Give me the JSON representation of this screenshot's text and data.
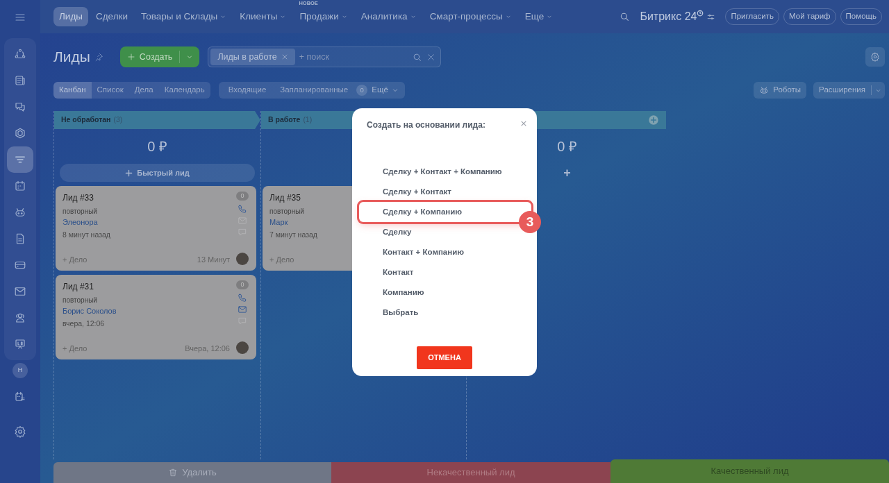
{
  "top_menu": [
    {
      "label": "Лиды",
      "selected": true,
      "caret": false
    },
    {
      "label": "Сделки",
      "selected": false,
      "caret": false
    },
    {
      "label": "Товары и Склады",
      "selected": false,
      "caret": true
    },
    {
      "label": "Клиенты",
      "selected": false,
      "caret": true
    },
    {
      "label": "Продажи",
      "selected": false,
      "caret": true,
      "badge": "НОВОЕ"
    },
    {
      "label": "Аналитика",
      "selected": false,
      "caret": true
    },
    {
      "label": "Смарт-процессы",
      "selected": false,
      "caret": true
    },
    {
      "label": "Еще",
      "selected": false,
      "caret": true
    }
  ],
  "logo": {
    "text": "Битрикс 24"
  },
  "header_buttons": [
    "Пригласить",
    "Мой тариф",
    "Помощь"
  ],
  "sidebar": {
    "items": [
      {
        "selected": false
      },
      {
        "selected": false
      },
      {
        "selected": false
      },
      {
        "selected": false
      },
      {
        "selected": true
      },
      {
        "selected": false
      },
      {
        "selected": false
      },
      {
        "selected": false
      },
      {
        "selected": false
      },
      {
        "selected": false
      },
      {
        "selected": false
      },
      {
        "selected": false
      }
    ],
    "avatar": "Н"
  },
  "page": {
    "title": "Лиды",
    "create_button": "Создать",
    "filter_chip": "Лиды в работе",
    "search_placeholder": "+ поиск"
  },
  "view_tabs": [
    {
      "label": "Канбан",
      "selected": true
    },
    {
      "label": "Список",
      "selected": false
    },
    {
      "label": "Дела",
      "selected": false
    },
    {
      "label": "Календарь",
      "selected": false
    }
  ],
  "counters": {
    "items": [
      "Входящие",
      "Запланированные"
    ],
    "count": "0",
    "more": "Ещё"
  },
  "robots_button": "Роботы",
  "extensions_button": "Расширения",
  "columns": [
    {
      "title": "Не обработан",
      "count": "(3)",
      "sum": "0 ₽",
      "quick_add": "Быстрый лид",
      "cards": [
        {
          "title": "Лид #33",
          "type": "повторный",
          "name": "Элеонора",
          "created": "8 минут назад",
          "activity_count": "0",
          "email_active": false,
          "add_activity": "+ Дело",
          "deadline": "13 Минут"
        },
        {
          "title": "Лид #31",
          "type": "повторный",
          "name": "Борис Соколов",
          "created": "вчера, 12:06",
          "activity_count": "0",
          "email_active": true,
          "add_activity": "+ Дело",
          "deadline": "Вчера, 12:06"
        }
      ]
    },
    {
      "title": "В работе",
      "count": "(1)",
      "cards": [
        {
          "title": "Лид #35",
          "type": "повторный",
          "name": "Марк",
          "created": "7 минут назад",
          "add_activity": "+ Дело"
        }
      ]
    },
    {
      "sum": "0 ₽",
      "add": "+"
    }
  ],
  "modal": {
    "title": "Создать на основании лида:",
    "options": [
      {
        "label": "Сделку + Контакт + Компанию",
        "selected": false
      },
      {
        "label": "Сделку + Контакт",
        "selected": false
      },
      {
        "label": "Сделку + Компанию",
        "selected": true
      },
      {
        "label": "Сделку",
        "selected": false
      },
      {
        "label": "Контакт + Компанию",
        "selected": false
      },
      {
        "label": "Контакт",
        "selected": false
      },
      {
        "label": "Компанию",
        "selected": false
      },
      {
        "label": "Выбрать",
        "selected": false
      }
    ],
    "step_marker": "3",
    "cancel_button": "ОТМЕНА"
  },
  "bottom_bar": {
    "delete": "Удалить",
    "bad": "Некачественный лид",
    "good": "Качественный лид"
  }
}
